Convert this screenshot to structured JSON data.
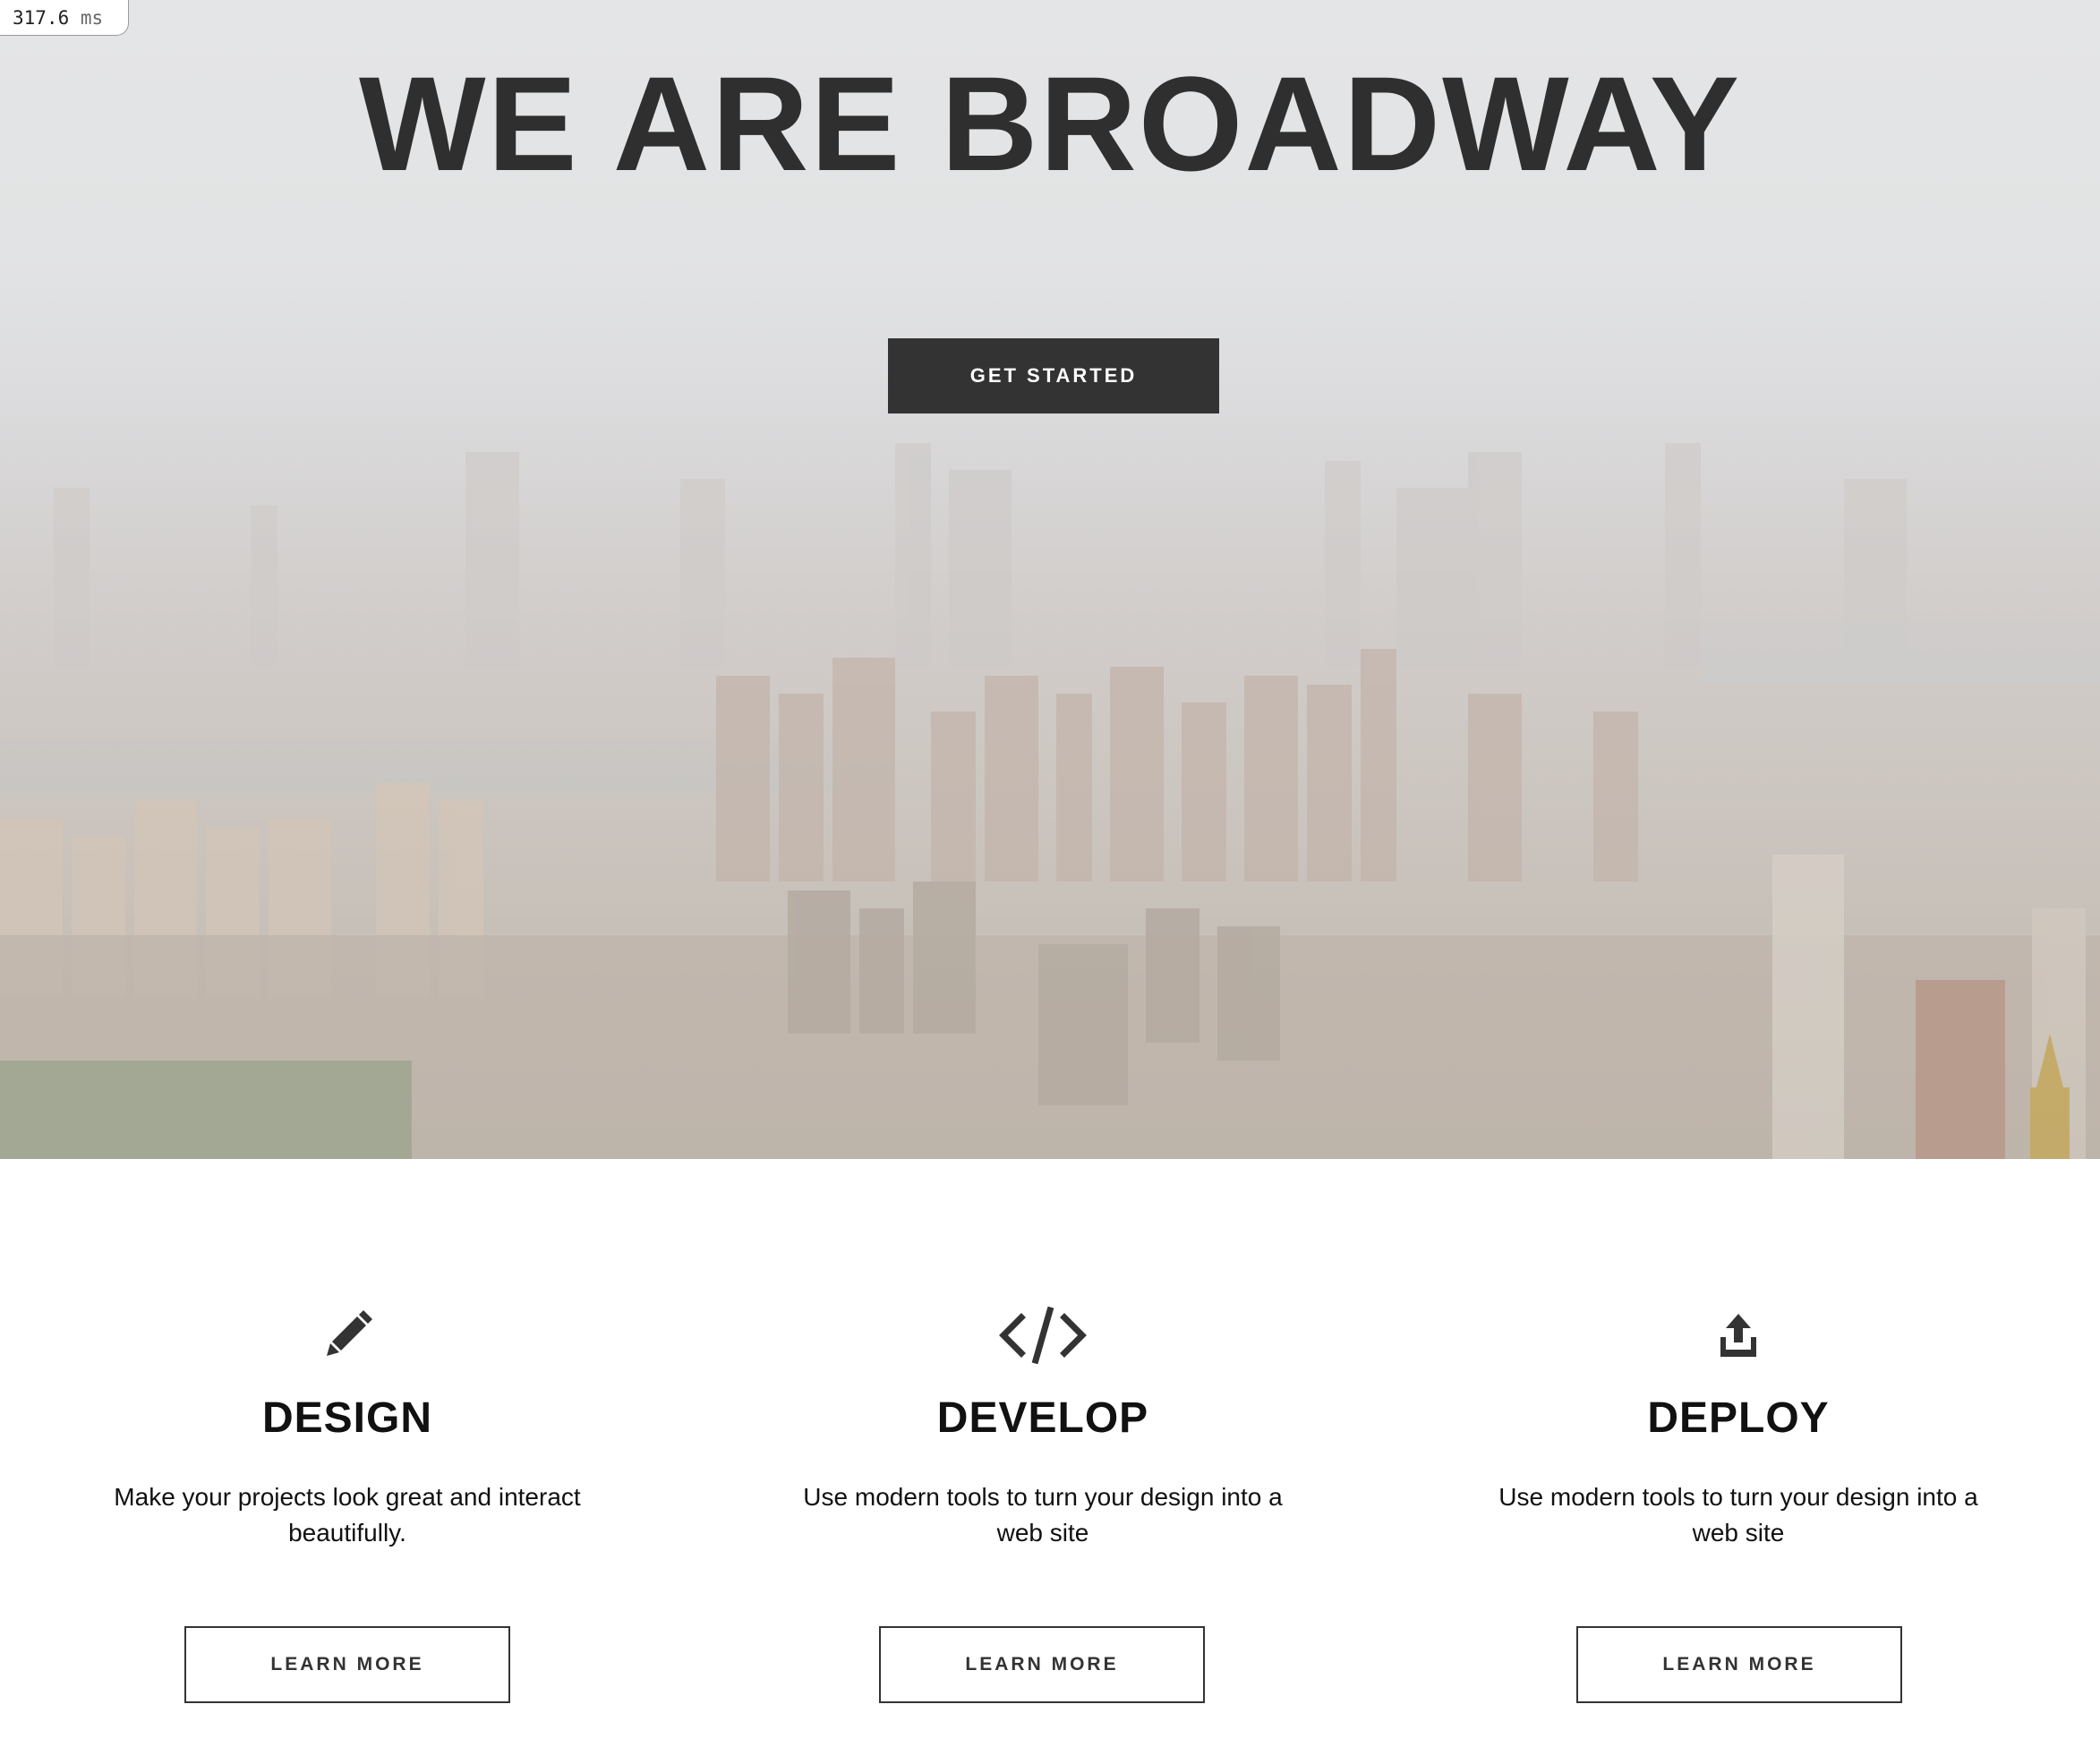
{
  "timer": {
    "value": "317.6",
    "unit": "ms"
  },
  "hero": {
    "title": "WE ARE BROADWAY",
    "button_label": "GET STARTED"
  },
  "features": [
    {
      "icon": "pencil-icon",
      "title": "DESIGN",
      "description": "Make your projects look great and interact beautifully.",
      "button_label": "LEARN MORE"
    },
    {
      "icon": "code-icon",
      "title": "DEVELOP",
      "description": "Use modern tools to turn your design into a web site",
      "button_label": "LEARN MORE"
    },
    {
      "icon": "upload-icon",
      "title": "DEPLOY",
      "description": "Use modern tools to turn your design into a web site",
      "button_label": "LEARN MORE"
    }
  ],
  "colors": {
    "dark": "#333333",
    "text": "#111111",
    "background": "#ffffff"
  }
}
